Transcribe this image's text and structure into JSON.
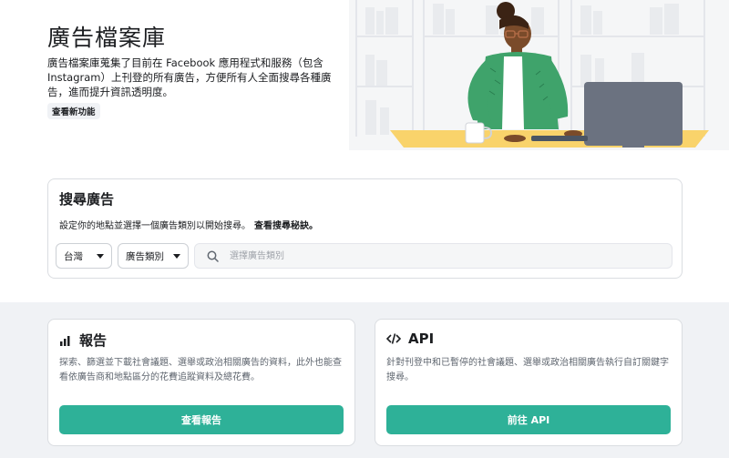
{
  "hero": {
    "title": "廣告檔案庫",
    "description": "廣告檔案庫蒐集了目前在 Facebook 應用程式和服務（包含 Instagram）上刊登的所有廣告，方便所有人全面搜尋各種廣告，進而提升資訊透明度。",
    "whats_new_label": "查看新功能"
  },
  "search": {
    "heading": "搜尋廣告",
    "hint": "設定你的地點並選擇一個廣告類別以開始搜尋。",
    "tips_link": "查看搜尋秘訣。",
    "country_value": "台灣",
    "category_value": "廣告類別",
    "placeholder": "選擇廣告類別"
  },
  "cards": {
    "report": {
      "title": "報告",
      "text": "探索、篩選並下載社會議題、選舉或政治相關廣告的資料，此外也能查看依廣告商和地點區分的花費追蹤資料及總花費。",
      "button": "查看報告"
    },
    "api": {
      "title": "API",
      "text": "針對刊登中和已暫停的社會議題、選舉或政治相關廣告執行自訂關鍵字搜尋。",
      "button": "前往 API"
    }
  },
  "colors": {
    "accent": "#2eb198",
    "section_bg": "#f0f2f5"
  }
}
